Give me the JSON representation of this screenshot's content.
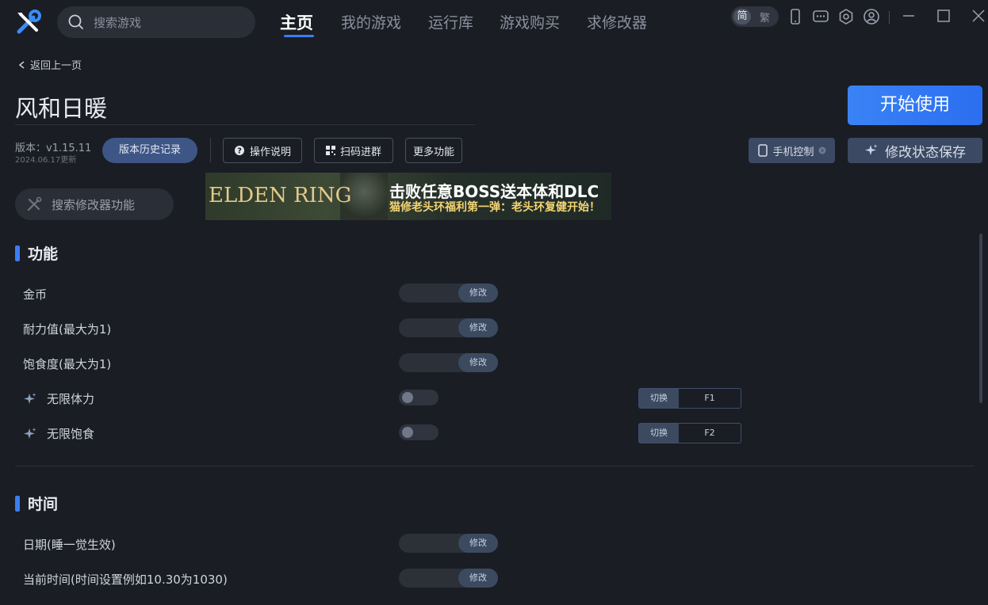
{
  "header": {
    "search_placeholder": "搜索游戏",
    "nav": [
      "主页",
      "我的游戏",
      "运行库",
      "游戏购买",
      "求修改器"
    ],
    "lang_simplified": "简",
    "lang_traditional": "繁"
  },
  "page": {
    "back_label": "返回上一页",
    "title": "风和日暖",
    "start_label": "开始使用",
    "version": "版本：v1.15.11",
    "version_date": "2024.06.17更新",
    "history_label": "版本历史记录",
    "guide_label": "操作说明",
    "scan_label": "扫码进群",
    "more_label": "更多功能",
    "phone_label": "手机控制",
    "save_label": "修改状态保存",
    "feature_search_placeholder": "搜索修改器功能"
  },
  "banner": {
    "logo": "ELDEN RING",
    "headline": "击败任意BOSS送本体和DLC",
    "subline": "猫修老头环福利第一弹：老头环复健开始！"
  },
  "sections": [
    {
      "title": "功能",
      "rows": [
        {
          "label": "金币",
          "control": "修改"
        },
        {
          "label": "耐力值(最大为1)",
          "control": "修改"
        },
        {
          "label": "饱食度(最大为1)",
          "control": "修改"
        },
        {
          "label": "无限体力",
          "hotkey_action": "切换",
          "hotkey": "F1",
          "on": false
        },
        {
          "label": "无限饱食",
          "hotkey_action": "切换",
          "hotkey": "F2",
          "on": false
        }
      ]
    },
    {
      "title": "时间",
      "rows": [
        {
          "label": "日期(睡一觉生效)",
          "control": "修改"
        },
        {
          "label": "当前时间(时间设置例如10.30为1030)",
          "control": "修改"
        }
      ]
    }
  ],
  "colors": {
    "accent": "#3d7cf2",
    "background": "#1a1d24"
  }
}
